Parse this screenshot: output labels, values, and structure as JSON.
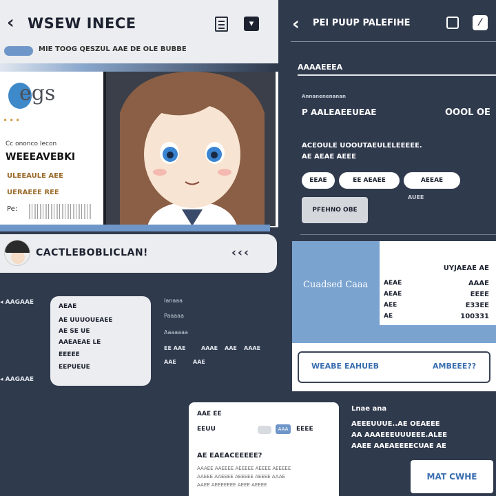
{
  "left_header": {
    "title": "WSEW INECE",
    "subtitle": "MIE TOOG QESZUL AAE DE OLE BUBBE"
  },
  "card": {
    "logo_text": "egs",
    "line1": "Cc ononco Iecon",
    "line2": "WEEEAVEBKI",
    "line3": "ULEEAULE AEE",
    "line4": "UERAEEE REE",
    "line5": "Pe:"
  },
  "chat": {
    "text": "CACTLEBOBLICLAN!",
    "arrows": "‹‹‹"
  },
  "lower_left": {
    "mark1": "AAGAAE",
    "mark2": "AAGAAE",
    "card_rows": [
      "AEAE",
      "AE UUUOUEAEE",
      "AE SE UE",
      "AAEAEAE LE",
      "EEEEE",
      "EEPUEUE"
    ],
    "side": [
      "Ianaaa",
      "Paaaaa",
      "Aaaaaaa"
    ],
    "row_small": [
      "EE AAE",
      "AAAE",
      "AAE",
      "AAAE"
    ],
    "row_small2": [
      "AAE",
      "AAE"
    ]
  },
  "bottom_middle": {
    "title": "AAE EE",
    "row1": "EEUU",
    "chip": "AAA",
    "chip_label": "EEEE",
    "question": "AE EAEACEEEEE?",
    "lines": [
      "AAAEE AAEEEE AEEEEE AEEEE AEEEEE",
      "AAEEE AAEEEE AEEEEE AEEEE AAAE",
      "AAEE AEEEEEEE AEEE AEEEE"
    ]
  },
  "right_header": {
    "title": "PEI PUUP PALEFIHE",
    "field": "AAAAEEEA"
  },
  "right_panel": {
    "small": "Annanenenanan",
    "row_label": "P AALEAEEUEAE",
    "row_value": "OOOL OE",
    "desc1": "ACEOULE UOOUTAEULELEEEEE.",
    "desc2": "AE AEAE AEEE",
    "tags": [
      "EEAE",
      "EE AEAEE",
      "AEEAE"
    ],
    "tag_note": "AUEE",
    "button": "PFEHNO OBE"
  },
  "blue_panel": {
    "label": "Cuadsed Caaa",
    "header": "UYJAEAE AE",
    "rows": [
      {
        "k": "AEAE",
        "v": "AAAE"
      },
      {
        "k": "AEAE",
        "v": "EEEE"
      },
      {
        "k": "AEE",
        "v": "E33EE"
      },
      {
        "k": "AE",
        "v": "100331"
      }
    ]
  },
  "cta": {
    "left": "WEABE EAHUEB",
    "right": "AMBEEE??"
  },
  "bottom_right": {
    "head": "Lnae ana",
    "lines": [
      "AEEEUUUE..AE OEAEEE",
      "AA AAAEEEUUUEEE.ALEE",
      "AAEE AAEAEEEECUAE AE"
    ],
    "button": "MAT CWHE"
  }
}
